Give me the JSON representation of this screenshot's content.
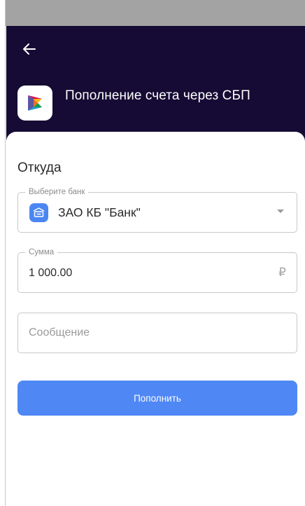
{
  "header": {
    "title": "Пополнение счета через СБП",
    "back_icon": "arrow-left-icon",
    "logo_icon": "sbp-logo-icon"
  },
  "form": {
    "section_title": "Откуда",
    "bank": {
      "label": "Выберите банк",
      "value": "ЗАО КБ \"Банк\"",
      "icon": "bank-icon"
    },
    "amount": {
      "label": "Сумма",
      "value": "1 000.00",
      "currency_symbol": "₽"
    },
    "message": {
      "placeholder": "Сообщение"
    },
    "submit_label": "Пополнить"
  },
  "colors": {
    "header_bg": "#150b34",
    "accent": "#4f87f5",
    "status_bar": "#a3a3a3"
  }
}
